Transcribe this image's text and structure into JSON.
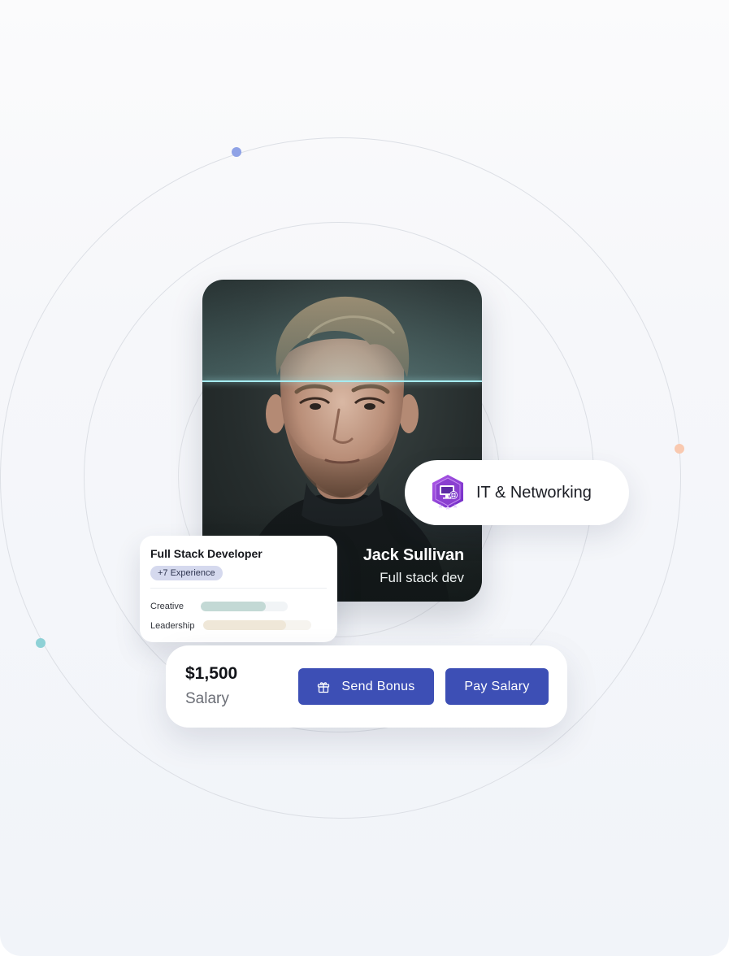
{
  "profile": {
    "name": "Jack Sullivan",
    "role": "Full stack dev"
  },
  "category": {
    "label": "IT & Networking",
    "icon": "it-networking-badge-icon",
    "accent": "#8a3fd0"
  },
  "skills_card": {
    "title": "Full Stack Developer",
    "experience_tag": "+7 Experience",
    "skills": [
      {
        "label": "Creative",
        "level": 0.75,
        "fill_color": "#c3d9d5",
        "track_color": "#f1f4f6"
      },
      {
        "label": "Leadership",
        "level": 0.77,
        "fill_color": "#efe7d8",
        "track_color": "#f6f4ef"
      }
    ]
  },
  "salary": {
    "amount": "$1,500",
    "label": "Salary",
    "send_bonus_label": "Send Bonus",
    "send_bonus_icon": "gift-icon",
    "pay_salary_label": "Pay Salary",
    "button_color": "#3d4fb5"
  },
  "decor": {
    "dot_colors": [
      "#8fa2e6",
      "#f9c9b0",
      "#8ed1d6"
    ]
  }
}
